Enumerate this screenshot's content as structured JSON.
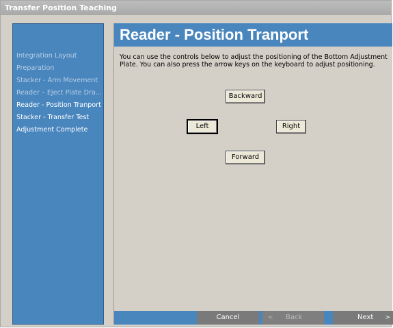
{
  "window": {
    "title": "Transfer Position Teaching"
  },
  "sidebar": {
    "items": [
      {
        "label": "Integration Layout",
        "state": "done"
      },
      {
        "label": "Preparation",
        "state": "done"
      },
      {
        "label": "Stacker - Arm Movement",
        "state": "done"
      },
      {
        "label": "Reader – Eject Plate Dra...",
        "state": "done"
      },
      {
        "label": "Reader - Position Tranport",
        "state": "current"
      },
      {
        "label": "Stacker - Transfer Test",
        "state": "pending"
      },
      {
        "label": "Adjustment Complete",
        "state": "pending"
      }
    ]
  },
  "main": {
    "title": "Reader - Position Tranport",
    "instructions": "You can use the controls below to adjust the positioning of the Bottom Adjustment Plate. You can also press the arrow keys on the keyboard to adjust positioning.",
    "controls": {
      "backward": "Backward",
      "left": "Left",
      "right": "Right",
      "forward": "Forward"
    }
  },
  "footer": {
    "cancel": "Cancel",
    "back": "Back",
    "next": "Next",
    "back_arrow": "<",
    "next_arrow": ">"
  },
  "colors": {
    "accent": "#4a86be",
    "title_bar": "#a9a9a9",
    "panel": "#d4d0c8"
  }
}
